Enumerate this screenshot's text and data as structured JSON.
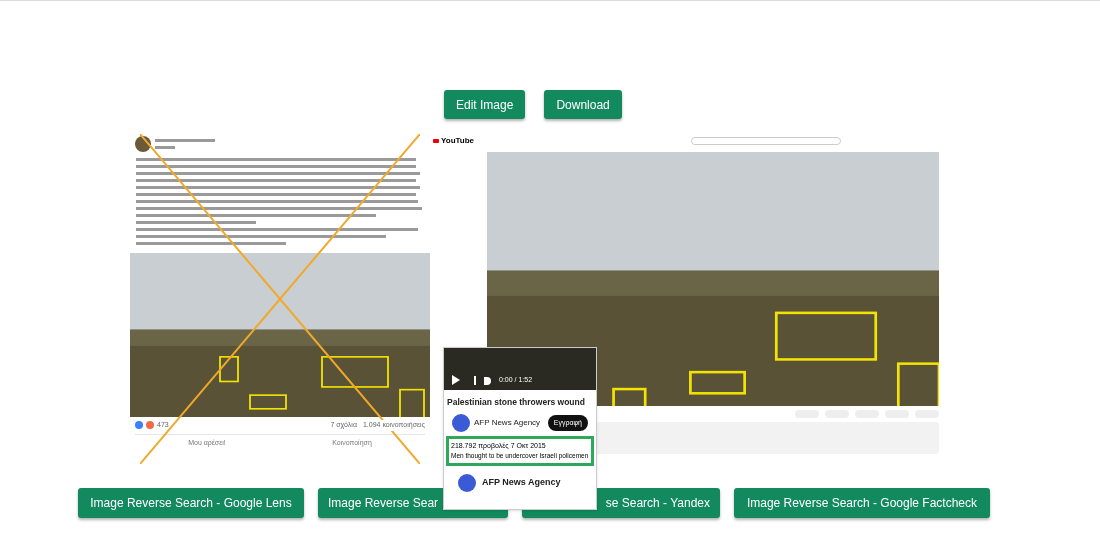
{
  "toolbar": {
    "buttons": [
      "Edit Image",
      "Download"
    ]
  },
  "image": {
    "facebook_post": {
      "reactions_count": "473",
      "comments": "7 σχόλια",
      "shares": "1.094 κοινοποιήσεις",
      "actions": [
        "Μου αρέσει!",
        "Κοινοποίηση"
      ]
    },
    "youtube": {
      "logo": "YouTube"
    },
    "popup": {
      "time": "0:00 / 1:52",
      "title": "Palestinian stone throwers wound",
      "channel": "AFP News Agency",
      "subscribe": "Εγγραφή",
      "views_date": "218.792 προβολές  7 Οκτ 2015",
      "description": "Men thought to be undercover Israeli policemen",
      "channel_2": "AFP News Agency"
    }
  },
  "search_buttons": [
    "Image Reverse Search - Google Lens",
    "Image Reverse Sear",
    "se Search - Yandex",
    "Image Reverse Search - Google Factcheck"
  ]
}
